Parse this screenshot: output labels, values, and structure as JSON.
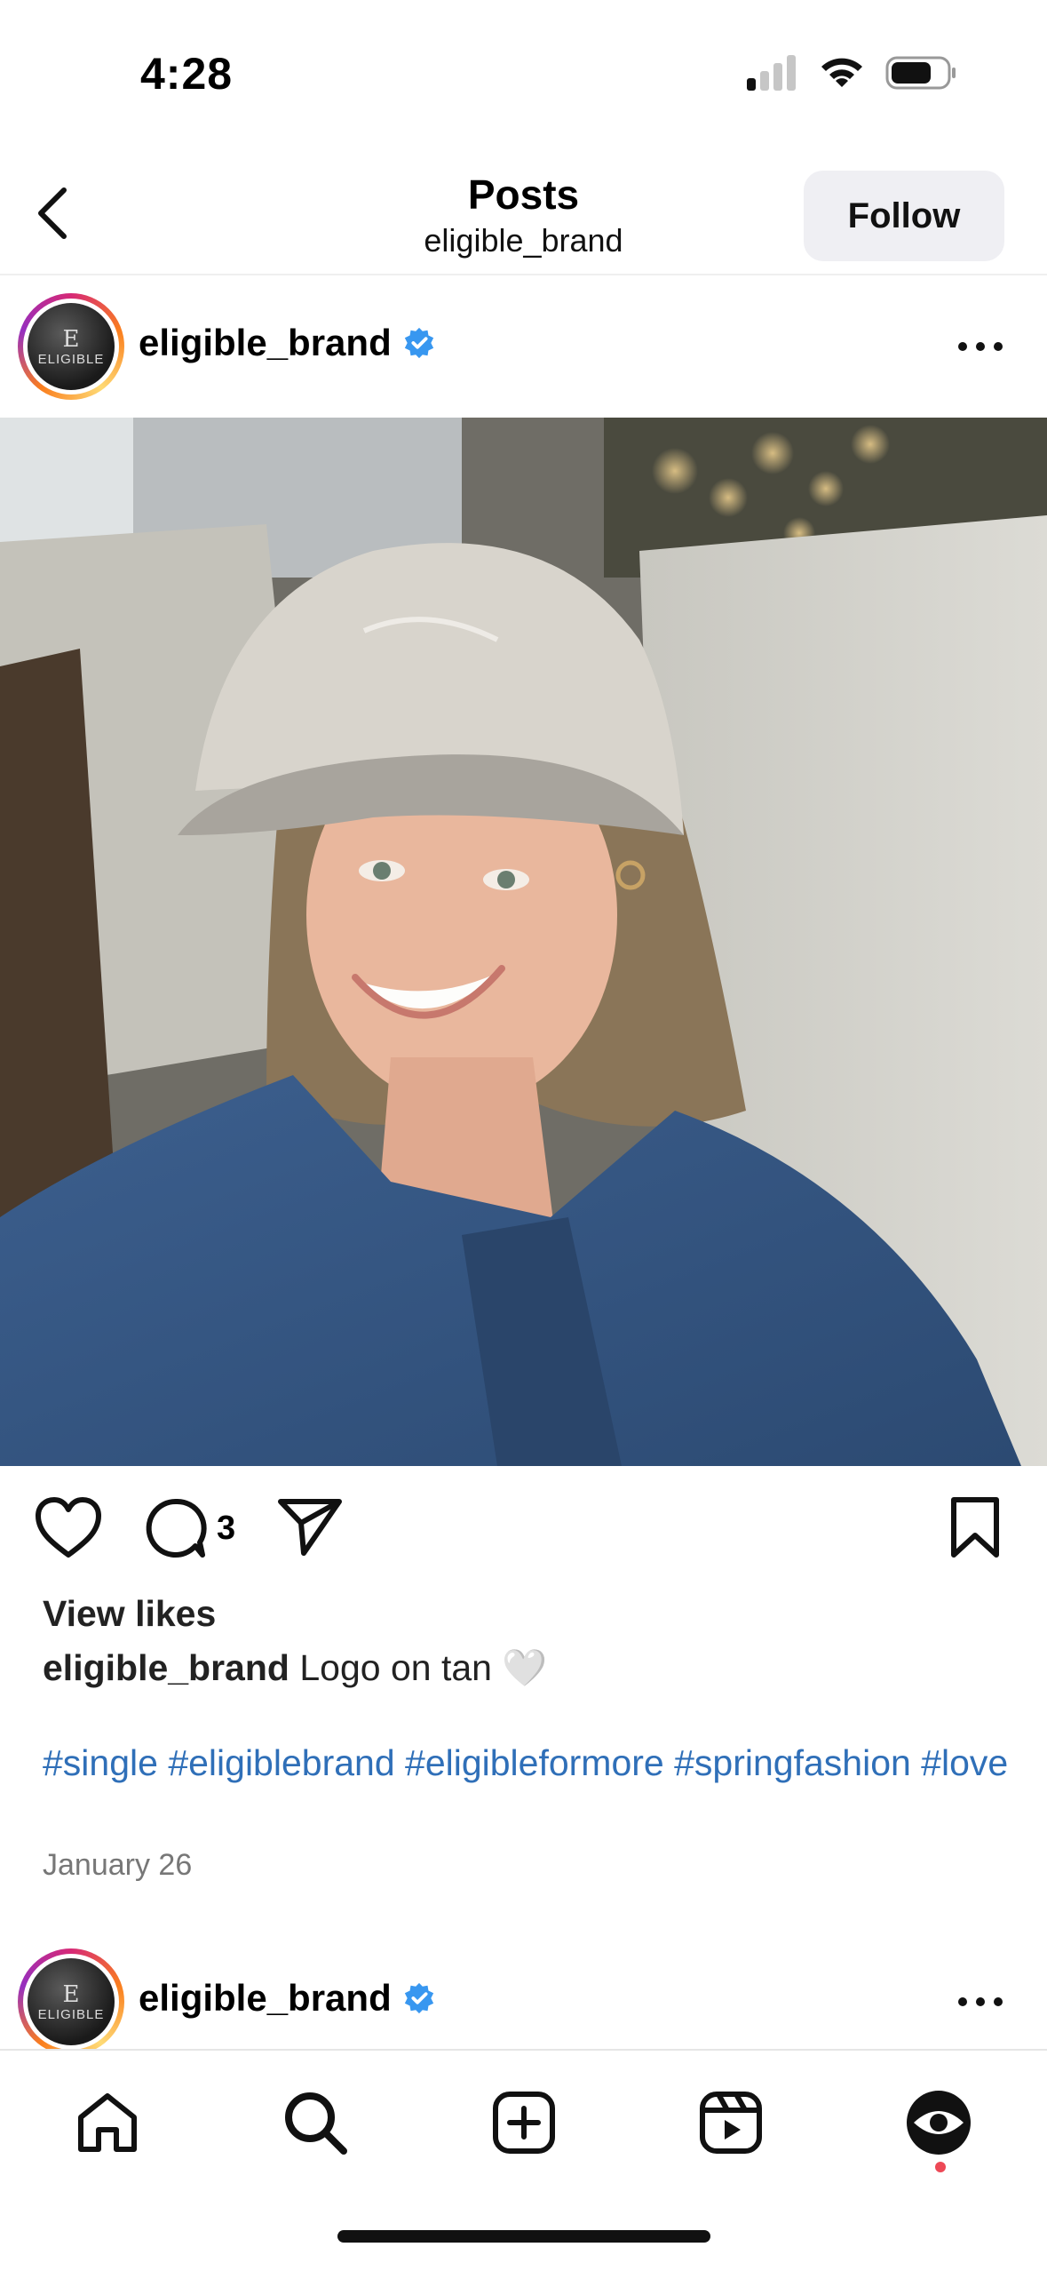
{
  "status_bar": {
    "time": "4:28"
  },
  "header": {
    "title": "Posts",
    "subtitle": "eligible_brand",
    "follow_label": "Follow"
  },
  "avatar": {
    "logo_letter": "E",
    "logo_word": "ELIGIBLE"
  },
  "post": {
    "username": "eligible_brand",
    "verified": true,
    "comment_count": "3",
    "view_likes_label": "View likes",
    "caption_user": "eligible_brand",
    "caption_text": " Logo on tan 🤍",
    "hashtags": "#single #eligiblebrand #eligibleformore #springfashion #love",
    "date": "January 26"
  },
  "next_post": {
    "username": "eligible_brand",
    "verified": true
  },
  "tabbar": {
    "items": [
      "home-icon",
      "search-icon",
      "create-icon",
      "reels-icon",
      "profile-avatar"
    ]
  },
  "colors": {
    "accent_blue": "#3897f0",
    "hashtag_blue": "#2f6fb8",
    "notification_red": "#ed4956"
  }
}
